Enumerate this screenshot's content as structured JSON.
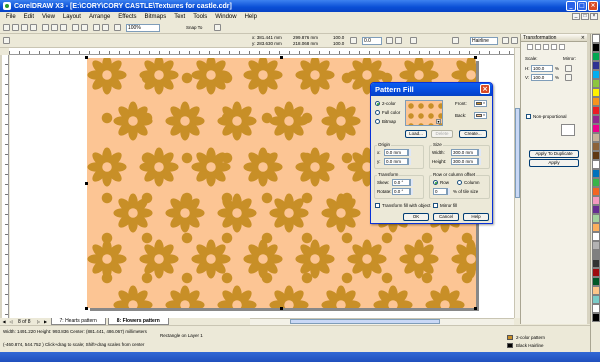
{
  "window": {
    "title": "CorelDRAW X3 - [E:\\CORY\\CORY CASTLE\\Textures for castle.cdr]",
    "controls": [
      "_",
      "□",
      "×"
    ]
  },
  "menu": [
    "File",
    "Edit",
    "View",
    "Layout",
    "Arrange",
    "Effects",
    "Bitmaps",
    "Text",
    "Tools",
    "Window",
    "Help"
  ],
  "toolbar": {
    "zoom": "100%",
    "snap": "Snap To",
    "pos_x": "x: 381.441 mm",
    "pos_y": "y: 283.630 mm",
    "width": "299.876 mm",
    "height": "218.068 mm",
    "scale_w": "100.0",
    "scale_h": "100.0",
    "angle": "0.0",
    "outline": "Hairline"
  },
  "page_tabs": {
    "counter": "8 of 8",
    "tabs": [
      "7: Hearts pattern",
      "8: Flowers pattern"
    ]
  },
  "status": {
    "line1": "Width: 1491.220 Height: 993.836  Center: (881.441, 486.067)  millimeters",
    "line1b": "Rectangle on Layer 1",
    "line2": "(-460.874, 544.752 )     Click+drag to scale; Shift+drag scales from center",
    "fill_label": "2-color pattern",
    "outline_label": "Black  Hairline"
  },
  "docker": {
    "title": "Transformation",
    "scale_label": "Scale:",
    "mirror_label": "Mirror:",
    "h_label": "H:",
    "v_label": "V:",
    "h_value": "100.0",
    "v_value": "100.0",
    "unit": "%",
    "nonprop_label": "Non-proportional",
    "duplicate_button": "Apply To Duplicate",
    "apply_button": "Apply"
  },
  "dialog": {
    "title": "Pattern Fill",
    "radio_2color": "2-color",
    "radio_fullcolor": "Full color",
    "radio_bitmap": "Bitmap",
    "front_label": "Front:",
    "back_label": "Back:",
    "load_button": "Load...",
    "delete_button": "Delete",
    "create_button": "Create...",
    "origin_label": "Origin",
    "size_label": "Size",
    "x_label": "x:",
    "y_label": "y:",
    "x_value": "0.0 mm",
    "y_value": "0.0 mm",
    "width_label": "Width:",
    "height_label": "Height:",
    "width_value": "300.0 mm",
    "height_value": "300.0 mm",
    "transform_label": "Transform",
    "offset_label": "Row or column offset",
    "skew_label": "Skew:",
    "rotate_label": "Rotate:",
    "skew_value": "0.0 °",
    "rotate_value": "0.0 °",
    "row_label": "Row",
    "column_label": "Column",
    "offset_value": "0",
    "tile_label": "% of tile size",
    "transform_fill_label": "Transform fill with object",
    "mirror_fill_label": "Mirror fill",
    "ok_button": "OK",
    "cancel_button": "Cancel",
    "help_button": "Help"
  },
  "colors": {
    "page_fill": "#fcc594",
    "flower": "#c88f27",
    "title_bar": "#0a4fd6",
    "palette": [
      "#ffffff",
      "#000000",
      "#00a651",
      "#2e3192",
      "#00aeef",
      "#8dc63f",
      "#fff200",
      "#f7941d",
      "#ed1c24",
      "#92278f",
      "#ec008c",
      "#c7b299",
      "#8c6239",
      "#603913",
      "#ffffff",
      "#0072bc",
      "#39b54a",
      "#f26522",
      "#f49ac1",
      "#662d91",
      "#a3d39c",
      "#fbaf5d",
      "#ffffff",
      "#b3b3b3",
      "#808080",
      "#333333",
      "#9e0b0f",
      "#005826",
      "#fdc689",
      "#7accc8",
      "#ffffff",
      "#000000"
    ]
  }
}
